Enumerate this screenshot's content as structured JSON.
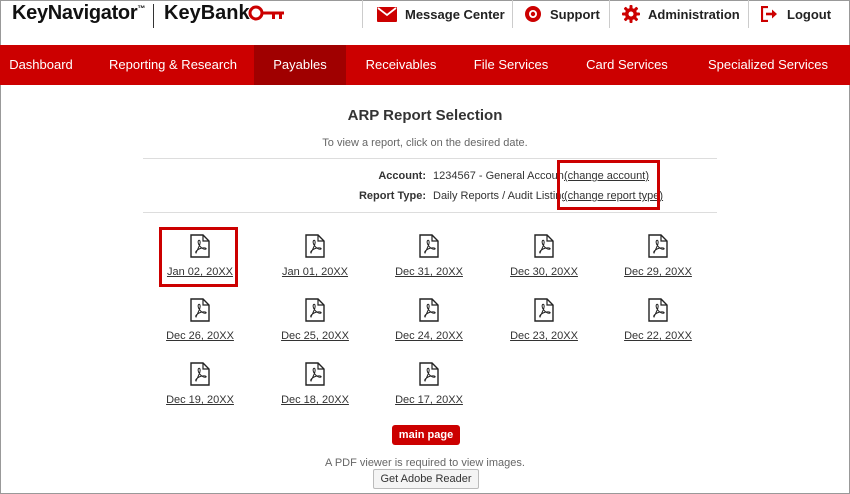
{
  "brand": {
    "product": "KeyNavigator",
    "tm": "™",
    "bank": "KeyBank"
  },
  "toplinks": [
    {
      "label": "Message Center",
      "icon": "envelope-icon"
    },
    {
      "label": "Support",
      "icon": "lifebuoy-icon"
    },
    {
      "label": "Administration",
      "icon": "gear-icon"
    },
    {
      "label": "Logout",
      "icon": "logout-icon"
    }
  ],
  "nav": [
    {
      "label": "Dashboard"
    },
    {
      "label": "Reporting & Research"
    },
    {
      "label": "Payables",
      "active": true
    },
    {
      "label": "Receivables"
    },
    {
      "label": "File Services"
    },
    {
      "label": "Card Services"
    },
    {
      "label": "Specialized Services"
    }
  ],
  "page": {
    "title": "ARP Report Selection",
    "subtitle": "To view a report, click on the desired date."
  },
  "account": {
    "label": "Account:",
    "value": "1234567 - General Account",
    "change": "(change account)"
  },
  "report_type": {
    "label": "Report Type:",
    "value": "Daily Reports / Audit Listing",
    "change": "(change report type)"
  },
  "reports": [
    "Jan 02, 20XX",
    "Jan 01, 20XX",
    "Dec 31, 20XX",
    "Dec 30, 20XX",
    "Dec 29, 20XX",
    "Dec 26, 20XX",
    "Dec 25, 20XX",
    "Dec 24, 20XX",
    "Dec 23, 20XX",
    "Dec 22, 20XX",
    "Dec 19, 20XX",
    "Dec 18, 20XX",
    "Dec 17, 20XX"
  ],
  "footer": {
    "main_page": "main page",
    "pdf_note": "A PDF viewer is required to view images.",
    "adobe": "Get Adobe Reader"
  },
  "colors": {
    "brand_red": "#cc0000",
    "active_nav": "#a00000",
    "highlight": "#cc0000"
  }
}
